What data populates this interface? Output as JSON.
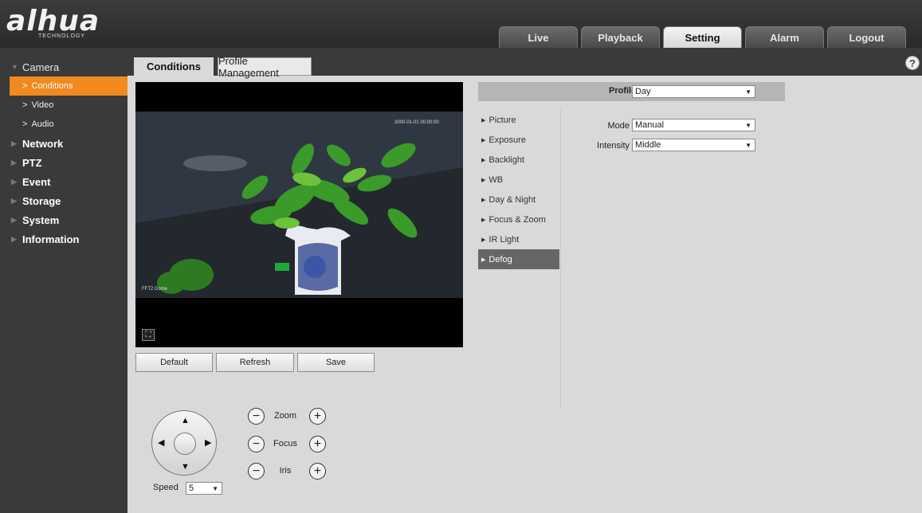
{
  "header": {
    "logo_text": "alhua",
    "logo_subtext": "TECHNOLOGY",
    "nav": [
      "Live",
      "Playback",
      "Setting",
      "Alarm",
      "Logout"
    ],
    "active_nav": "Setting"
  },
  "sidebar": {
    "camera": "Camera",
    "camera_items": [
      "Conditions",
      "Video",
      "Audio"
    ],
    "categories": [
      "Network",
      "PTZ",
      "Event",
      "Storage",
      "System",
      "Information"
    ]
  },
  "tabs": {
    "conditions": "Conditions",
    "profile_management": "Profile Management"
  },
  "help_icon": "?",
  "video": {
    "timestamp": "2000-01-01 00:00:00",
    "channel_label": "FFT2 Dome"
  },
  "buttons": {
    "default": "Default",
    "refresh": "Refresh",
    "save": "Save"
  },
  "ptz": {
    "zoom": "Zoom",
    "focus": "Focus",
    "iris": "Iris",
    "speed_label": "Speed",
    "speed_value": "5"
  },
  "panel": {
    "profile_label": "Profile",
    "profile_value": "Day",
    "menu": [
      "Picture",
      "Exposure",
      "Backlight",
      "WB",
      "Day & Night",
      "Focus & Zoom",
      "IR Light",
      "Defog"
    ],
    "active_menu": "Defog",
    "mode_label": "Mode",
    "mode_value": "Manual",
    "intensity_label": "Intensity",
    "intensity_value": "Middle"
  },
  "colors": {
    "accent": "#f08a1f",
    "sidebar_bg": "#3a3a3a",
    "content_bg": "#d9d9d9"
  }
}
